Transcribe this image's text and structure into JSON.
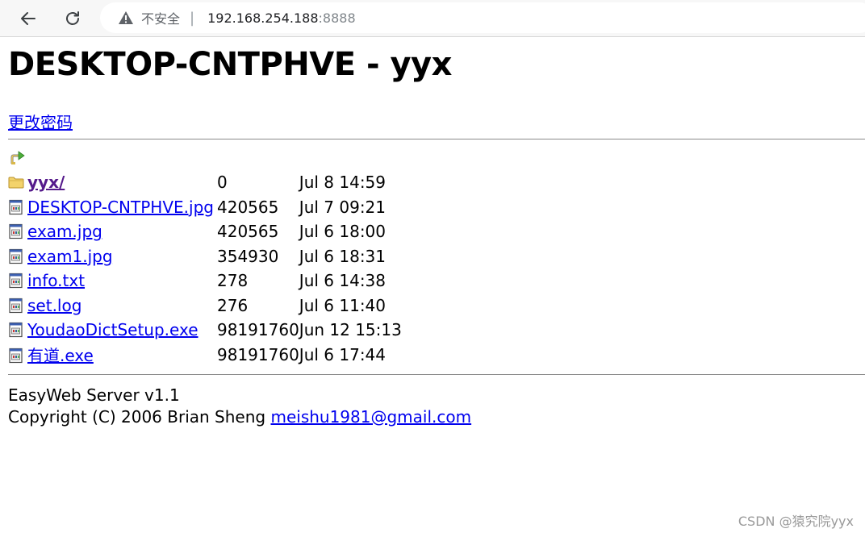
{
  "browser": {
    "security_label": "不安全",
    "separator": "|",
    "url_host": "192.168.254.188",
    "url_port": ":8888"
  },
  "page": {
    "title": "DESKTOP-CNTPHVE - yyx",
    "change_password_link": "更改密码",
    "files": [
      {
        "name": "yyx/",
        "size": "0",
        "modified": "Jul 8 14:59",
        "icon": "folder-icon"
      },
      {
        "name": "DESKTOP-CNTPHVE.jpg",
        "size": "420565",
        "modified": "Jul 7 09:21",
        "icon": "file-icon"
      },
      {
        "name": "exam.jpg",
        "size": "420565",
        "modified": "Jul 6 18:00",
        "icon": "file-icon"
      },
      {
        "name": "exam1.jpg",
        "size": "354930",
        "modified": "Jul 6 18:31",
        "icon": "file-icon"
      },
      {
        "name": "info.txt",
        "size": "278",
        "modified": "Jul 6 14:38",
        "icon": "file-icon"
      },
      {
        "name": "set.log",
        "size": "276",
        "modified": "Jul 6 11:40",
        "icon": "file-icon"
      },
      {
        "name": "YoudaoDictSetup.exe",
        "size": "98191760",
        "modified": "Jun 12 15:13",
        "icon": "file-icon"
      },
      {
        "name": "有道.exe",
        "size": "98191760",
        "modified": "Jul 6 17:44",
        "icon": "file-icon"
      }
    ],
    "footer": {
      "server": "EasyWeb Server v1.1",
      "copyright": "Copyright (C) 2006 Brian Sheng",
      "email": "meishu1981@gmail.com"
    }
  },
  "watermark": "CSDN @猿究院yyx"
}
